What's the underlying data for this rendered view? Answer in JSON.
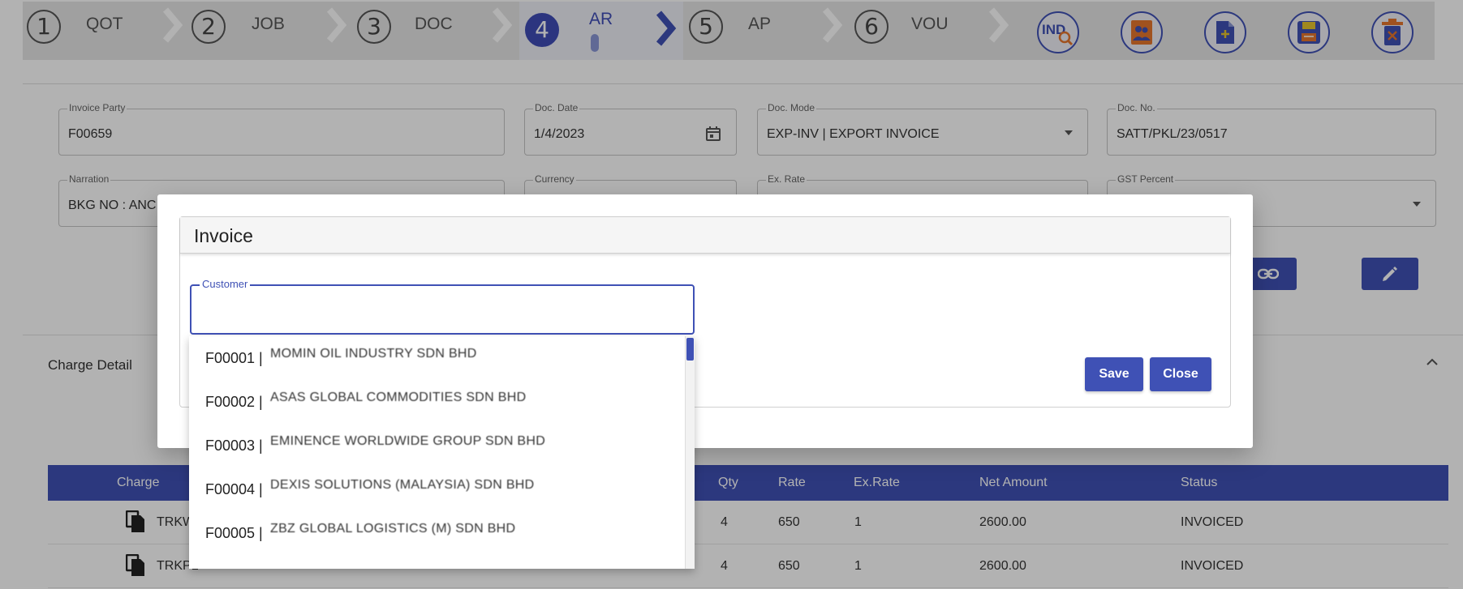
{
  "stepper": {
    "steps": [
      {
        "num": "1",
        "label": "QOT"
      },
      {
        "num": "2",
        "label": "JOB"
      },
      {
        "num": "3",
        "label": "DOC"
      },
      {
        "num": "4",
        "label": "AR"
      },
      {
        "num": "5",
        "label": "AP"
      },
      {
        "num": "6",
        "label": "VOU"
      }
    ],
    "active_step": "4",
    "toolbar": {
      "ind_label": "IND",
      "icons": [
        "ind-search-icon",
        "contacts-icon",
        "new-document-icon",
        "save-disk-icon",
        "delete-bin-icon"
      ]
    }
  },
  "form": {
    "invoice_party": {
      "label": "Invoice Party",
      "value": "F00659"
    },
    "doc_date": {
      "label": "Doc. Date",
      "value": "1/4/2023"
    },
    "doc_mode": {
      "label": "Doc. Mode",
      "value": "EXP-INV | EXPORT INVOICE"
    },
    "doc_no": {
      "label": "Doc. No.",
      "value": "SATT/PKL/23/0517"
    },
    "narration": {
      "label": "Narration",
      "value": "BKG NO : ANC"
    },
    "currency": {
      "label": "Currency",
      "value": ""
    },
    "ex_rate": {
      "label": "Ex. Rate",
      "value": ""
    },
    "gst_percent": {
      "label": "GST Percent",
      "value": ""
    }
  },
  "charge_detail": {
    "title": "Charge Detail",
    "columns": {
      "charge": "Charge",
      "qty": "Qty",
      "rate": "Rate",
      "ex_rate": "Ex.Rate",
      "net_amount": "Net Amount",
      "status": "Status"
    },
    "rows": [
      {
        "charge": "TRKW",
        "qty": "4",
        "rate": "650",
        "ex_rate": "1",
        "net_amount": "2600.00",
        "status": "INVOICED"
      },
      {
        "charge": "TRKPL",
        "qty": "4",
        "rate": "650",
        "ex_rate": "1",
        "net_amount": "2600.00",
        "status": "INVOICED"
      }
    ]
  },
  "modal": {
    "title": "Invoice",
    "customer": {
      "label": "Customer",
      "value": "",
      "placeholder": ""
    },
    "save_label": "Save",
    "close_label": "Close",
    "options": [
      {
        "code": "F00001 |",
        "name": "MOMIN OIL INDUSTRY SDN BHD"
      },
      {
        "code": "F00002 |",
        "name": "ASAS GLOBAL COMMODITIES SDN BHD"
      },
      {
        "code": "F00003 |",
        "name": "EMINENCE WORLDWIDE GROUP SDN BHD"
      },
      {
        "code": "F00004 |",
        "name": "DEXIS SOLUTIONS (MALAYSIA) SDN BHD"
      },
      {
        "code": "F00005 |",
        "name": "ZBZ GLOBAL LOGISTICS (M) SDN BHD"
      }
    ]
  },
  "colors": {
    "primary": "#3f51b5",
    "stepper_bg": "#e6e6e6"
  }
}
